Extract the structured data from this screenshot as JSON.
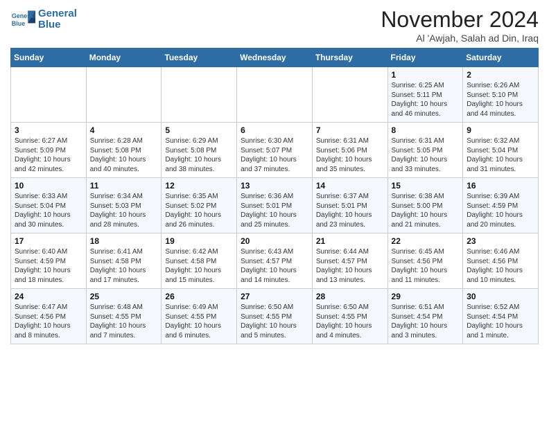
{
  "header": {
    "logo_line1": "General",
    "logo_line2": "Blue",
    "title": "November 2024",
    "subtitle": "Al 'Awjah, Salah ad Din, Iraq"
  },
  "weekdays": [
    "Sunday",
    "Monday",
    "Tuesday",
    "Wednesday",
    "Thursday",
    "Friday",
    "Saturday"
  ],
  "weeks": [
    [
      {
        "day": "",
        "content": ""
      },
      {
        "day": "",
        "content": ""
      },
      {
        "day": "",
        "content": ""
      },
      {
        "day": "",
        "content": ""
      },
      {
        "day": "",
        "content": ""
      },
      {
        "day": "1",
        "content": "Sunrise: 6:25 AM\nSunset: 5:11 PM\nDaylight: 10 hours\nand 46 minutes."
      },
      {
        "day": "2",
        "content": "Sunrise: 6:26 AM\nSunset: 5:10 PM\nDaylight: 10 hours\nand 44 minutes."
      }
    ],
    [
      {
        "day": "3",
        "content": "Sunrise: 6:27 AM\nSunset: 5:09 PM\nDaylight: 10 hours\nand 42 minutes."
      },
      {
        "day": "4",
        "content": "Sunrise: 6:28 AM\nSunset: 5:08 PM\nDaylight: 10 hours\nand 40 minutes."
      },
      {
        "day": "5",
        "content": "Sunrise: 6:29 AM\nSunset: 5:08 PM\nDaylight: 10 hours\nand 38 minutes."
      },
      {
        "day": "6",
        "content": "Sunrise: 6:30 AM\nSunset: 5:07 PM\nDaylight: 10 hours\nand 37 minutes."
      },
      {
        "day": "7",
        "content": "Sunrise: 6:31 AM\nSunset: 5:06 PM\nDaylight: 10 hours\nand 35 minutes."
      },
      {
        "day": "8",
        "content": "Sunrise: 6:31 AM\nSunset: 5:05 PM\nDaylight: 10 hours\nand 33 minutes."
      },
      {
        "day": "9",
        "content": "Sunrise: 6:32 AM\nSunset: 5:04 PM\nDaylight: 10 hours\nand 31 minutes."
      }
    ],
    [
      {
        "day": "10",
        "content": "Sunrise: 6:33 AM\nSunset: 5:04 PM\nDaylight: 10 hours\nand 30 minutes."
      },
      {
        "day": "11",
        "content": "Sunrise: 6:34 AM\nSunset: 5:03 PM\nDaylight: 10 hours\nand 28 minutes."
      },
      {
        "day": "12",
        "content": "Sunrise: 6:35 AM\nSunset: 5:02 PM\nDaylight: 10 hours\nand 26 minutes."
      },
      {
        "day": "13",
        "content": "Sunrise: 6:36 AM\nSunset: 5:01 PM\nDaylight: 10 hours\nand 25 minutes."
      },
      {
        "day": "14",
        "content": "Sunrise: 6:37 AM\nSunset: 5:01 PM\nDaylight: 10 hours\nand 23 minutes."
      },
      {
        "day": "15",
        "content": "Sunrise: 6:38 AM\nSunset: 5:00 PM\nDaylight: 10 hours\nand 21 minutes."
      },
      {
        "day": "16",
        "content": "Sunrise: 6:39 AM\nSunset: 4:59 PM\nDaylight: 10 hours\nand 20 minutes."
      }
    ],
    [
      {
        "day": "17",
        "content": "Sunrise: 6:40 AM\nSunset: 4:59 PM\nDaylight: 10 hours\nand 18 minutes."
      },
      {
        "day": "18",
        "content": "Sunrise: 6:41 AM\nSunset: 4:58 PM\nDaylight: 10 hours\nand 17 minutes."
      },
      {
        "day": "19",
        "content": "Sunrise: 6:42 AM\nSunset: 4:58 PM\nDaylight: 10 hours\nand 15 minutes."
      },
      {
        "day": "20",
        "content": "Sunrise: 6:43 AM\nSunset: 4:57 PM\nDaylight: 10 hours\nand 14 minutes."
      },
      {
        "day": "21",
        "content": "Sunrise: 6:44 AM\nSunset: 4:57 PM\nDaylight: 10 hours\nand 13 minutes."
      },
      {
        "day": "22",
        "content": "Sunrise: 6:45 AM\nSunset: 4:56 PM\nDaylight: 10 hours\nand 11 minutes."
      },
      {
        "day": "23",
        "content": "Sunrise: 6:46 AM\nSunset: 4:56 PM\nDaylight: 10 hours\nand 10 minutes."
      }
    ],
    [
      {
        "day": "24",
        "content": "Sunrise: 6:47 AM\nSunset: 4:56 PM\nDaylight: 10 hours\nand 8 minutes."
      },
      {
        "day": "25",
        "content": "Sunrise: 6:48 AM\nSunset: 4:55 PM\nDaylight: 10 hours\nand 7 minutes."
      },
      {
        "day": "26",
        "content": "Sunrise: 6:49 AM\nSunset: 4:55 PM\nDaylight: 10 hours\nand 6 minutes."
      },
      {
        "day": "27",
        "content": "Sunrise: 6:50 AM\nSunset: 4:55 PM\nDaylight: 10 hours\nand 5 minutes."
      },
      {
        "day": "28",
        "content": "Sunrise: 6:50 AM\nSunset: 4:55 PM\nDaylight: 10 hours\nand 4 minutes."
      },
      {
        "day": "29",
        "content": "Sunrise: 6:51 AM\nSunset: 4:54 PM\nDaylight: 10 hours\nand 3 minutes."
      },
      {
        "day": "30",
        "content": "Sunrise: 6:52 AM\nSunset: 4:54 PM\nDaylight: 10 hours\nand 1 minute."
      }
    ]
  ]
}
